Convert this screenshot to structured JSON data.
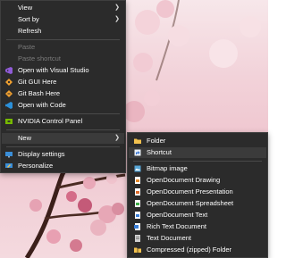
{
  "context_menu": {
    "items": [
      {
        "label": "View"
      },
      {
        "label": "Sort by"
      },
      {
        "label": "Refresh"
      },
      {
        "label": "Paste"
      },
      {
        "label": "Paste shortcut"
      },
      {
        "label": "Open with Visual Studio",
        "icon": "visual-studio-icon",
        "color": "#8f5bd6"
      },
      {
        "label": "Git GUI Here",
        "icon": "git-gui-icon",
        "color": "#f0a030"
      },
      {
        "label": "Git Bash Here",
        "icon": "git-bash-icon",
        "color": "#f0a030"
      },
      {
        "label": "Open with Code",
        "icon": "vscode-icon",
        "color": "#2b8fd8"
      },
      {
        "label": "NVIDIA Control Panel",
        "icon": "nvidia-icon",
        "color": "#76b900"
      },
      {
        "label": "New"
      },
      {
        "label": "Display settings",
        "icon": "display-icon",
        "color": "#3a8ed8"
      },
      {
        "label": "Personalize",
        "icon": "personalize-icon",
        "color": "#3a8ed8"
      }
    ],
    "arrow_glyph": "❯"
  },
  "new_submenu": {
    "items": [
      {
        "label": "Folder",
        "icon": "folder-icon",
        "color": "#f2c14e"
      },
      {
        "label": "Shortcut",
        "icon": "shortcut-icon",
        "color": "#8fb3d9"
      },
      {
        "label": "Bitmap image",
        "icon": "bitmap-icon",
        "color": "#58a6d6"
      },
      {
        "label": "OpenDocument Drawing",
        "icon": "odg-icon",
        "color": "#e78a2b"
      },
      {
        "label": "OpenDocument Presentation",
        "icon": "odp-icon",
        "color": "#e06b2b"
      },
      {
        "label": "OpenDocument Spreadsheet",
        "icon": "ods-icon",
        "color": "#3fae49"
      },
      {
        "label": "OpenDocument Text",
        "icon": "odt-icon",
        "color": "#3a7fd8"
      },
      {
        "label": "Rich Text Document",
        "icon": "rtf-icon",
        "color": "#3a7fd8"
      },
      {
        "label": "Text Document",
        "icon": "text-doc-icon",
        "color": "#cfcfcf"
      },
      {
        "label": "Compressed (zipped) Folder",
        "icon": "zip-folder-icon",
        "color": "#f2c14e"
      }
    ]
  }
}
